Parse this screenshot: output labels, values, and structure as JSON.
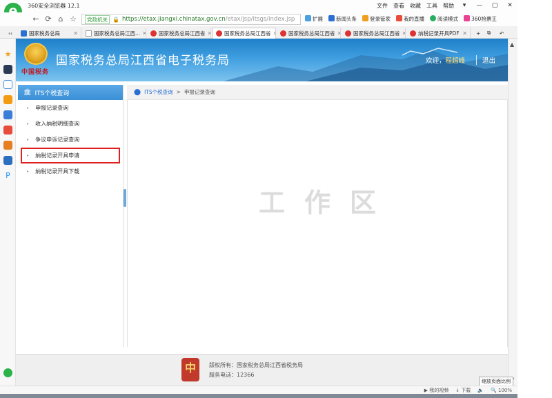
{
  "browser": {
    "title": "360安全浏览器 12.1",
    "menu": [
      "文件",
      "查看",
      "收藏",
      "工具",
      "帮助"
    ],
    "url_badge": "党政机关",
    "url_host": "https://etax.jiangxi.chinatax.gov.cn",
    "url_path": "/etax/jsp/itsgs/index.jsp",
    "addr_extras": [
      "扩展",
      "新闻头条",
      "登录管家",
      "我的直播",
      "阅读模式",
      "360抢票王"
    ],
    "tabs": [
      {
        "label": "国家税务总局",
        "active": false
      },
      {
        "label": "国家税务总局江西...",
        "active": false
      },
      {
        "label": "国家税务总局江西省",
        "active": false
      },
      {
        "label": "国家税务总局江西省",
        "active": true
      },
      {
        "label": "国家税务总局江西省",
        "active": false
      },
      {
        "label": "国家税务总局江西省",
        "active": false
      },
      {
        "label": "纳税记录开具PDF",
        "active": false
      }
    ],
    "status": {
      "video": "我的视频",
      "download": "下载",
      "zoom": "100%"
    },
    "zoom_tip": "缩放页面比例"
  },
  "header": {
    "emblem_text": "中国税务",
    "site_title": "国家税务总局江西省电子税务局",
    "welcome": "欢迎，",
    "user": "程超峰",
    "logout": "退出"
  },
  "sidebar": {
    "title": "ITS个税查询",
    "items": [
      {
        "label": "申报记录查询",
        "selected": false
      },
      {
        "label": "收入纳税明细查询",
        "selected": false
      },
      {
        "label": "争议申诉记录查询",
        "selected": false
      },
      {
        "label": "纳税记录开具申请",
        "selected": true
      },
      {
        "label": "纳税记录开具下载",
        "selected": false
      }
    ]
  },
  "breadcrumb": {
    "root": "ITS个税查询",
    "separator": ">",
    "current": "申报记录查询"
  },
  "work_area_label": "工作区",
  "footer": {
    "logo_text": "中",
    "copyright": "版权所有：国家税务总局江西省税务局",
    "phone": "服务电话：12366"
  },
  "colors": {
    "accent": "#3b8fd6",
    "highlight": "#e02020",
    "banner": "#1f7fc8"
  }
}
